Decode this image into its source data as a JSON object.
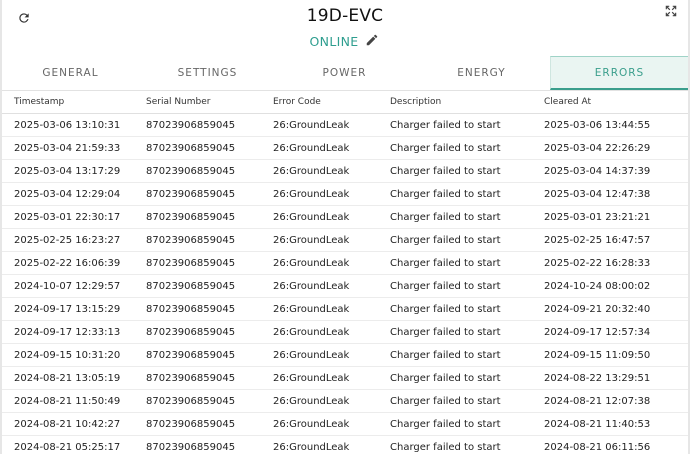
{
  "header": {
    "title": "19D-EVC",
    "status": "ONLINE"
  },
  "tabs": [
    {
      "label": "GENERAL",
      "active": false
    },
    {
      "label": "SETTINGS",
      "active": false
    },
    {
      "label": "POWER",
      "active": false
    },
    {
      "label": "ENERGY",
      "active": false
    },
    {
      "label": "ERRORS",
      "active": true
    }
  ],
  "colors": {
    "accent": "#3a9e8c",
    "status": "#2f9e8f",
    "active_tab_bg": "#eaf5f2"
  },
  "icons": {
    "refresh": "refresh-icon",
    "expand": "expand-icon",
    "edit": "pencil-icon"
  },
  "table": {
    "columns": [
      "Timestamp",
      "Serial Number",
      "Error Code",
      "Description",
      "Cleared At"
    ],
    "rows": [
      [
        "2025-03-06 13:10:31",
        "87023906859045",
        "26:GroundLeak",
        "Charger failed to start",
        "2025-03-06 13:44:55"
      ],
      [
        "2025-03-04 21:59:33",
        "87023906859045",
        "26:GroundLeak",
        "Charger failed to start",
        "2025-03-04 22:26:29"
      ],
      [
        "2025-03-04 13:17:29",
        "87023906859045",
        "26:GroundLeak",
        "Charger failed to start",
        "2025-03-04 14:37:39"
      ],
      [
        "2025-03-04 12:29:04",
        "87023906859045",
        "26:GroundLeak",
        "Charger failed to start",
        "2025-03-04 12:47:38"
      ],
      [
        "2025-03-01 22:30:17",
        "87023906859045",
        "26:GroundLeak",
        "Charger failed to start",
        "2025-03-01 23:21:21"
      ],
      [
        "2025-02-25 16:23:27",
        "87023906859045",
        "26:GroundLeak",
        "Charger failed to start",
        "2025-02-25 16:47:57"
      ],
      [
        "2025-02-22 16:06:39",
        "87023906859045",
        "26:GroundLeak",
        "Charger failed to start",
        "2025-02-22 16:28:33"
      ],
      [
        "2024-10-07 12:29:57",
        "87023906859045",
        "26:GroundLeak",
        "Charger failed to start",
        "2024-10-24 08:00:02"
      ],
      [
        "2024-09-17 13:15:29",
        "87023906859045",
        "26:GroundLeak",
        "Charger failed to start",
        "2024-09-21 20:32:40"
      ],
      [
        "2024-09-17 12:33:13",
        "87023906859045",
        "26:GroundLeak",
        "Charger failed to start",
        "2024-09-17 12:57:34"
      ],
      [
        "2024-09-15 10:31:20",
        "87023906859045",
        "26:GroundLeak",
        "Charger failed to start",
        "2024-09-15 11:09:50"
      ],
      [
        "2024-08-21 13:05:19",
        "87023906859045",
        "26:GroundLeak",
        "Charger failed to start",
        "2024-08-22 13:29:51"
      ],
      [
        "2024-08-21 11:50:49",
        "87023906859045",
        "26:GroundLeak",
        "Charger failed to start",
        "2024-08-21 12:07:38"
      ],
      [
        "2024-08-21 10:42:27",
        "87023906859045",
        "26:GroundLeak",
        "Charger failed to start",
        "2024-08-21 11:40:53"
      ],
      [
        "2024-08-21 05:25:17",
        "87023906859045",
        "26:GroundLeak",
        "Charger failed to start",
        "2024-08-21 06:11:56"
      ]
    ]
  }
}
